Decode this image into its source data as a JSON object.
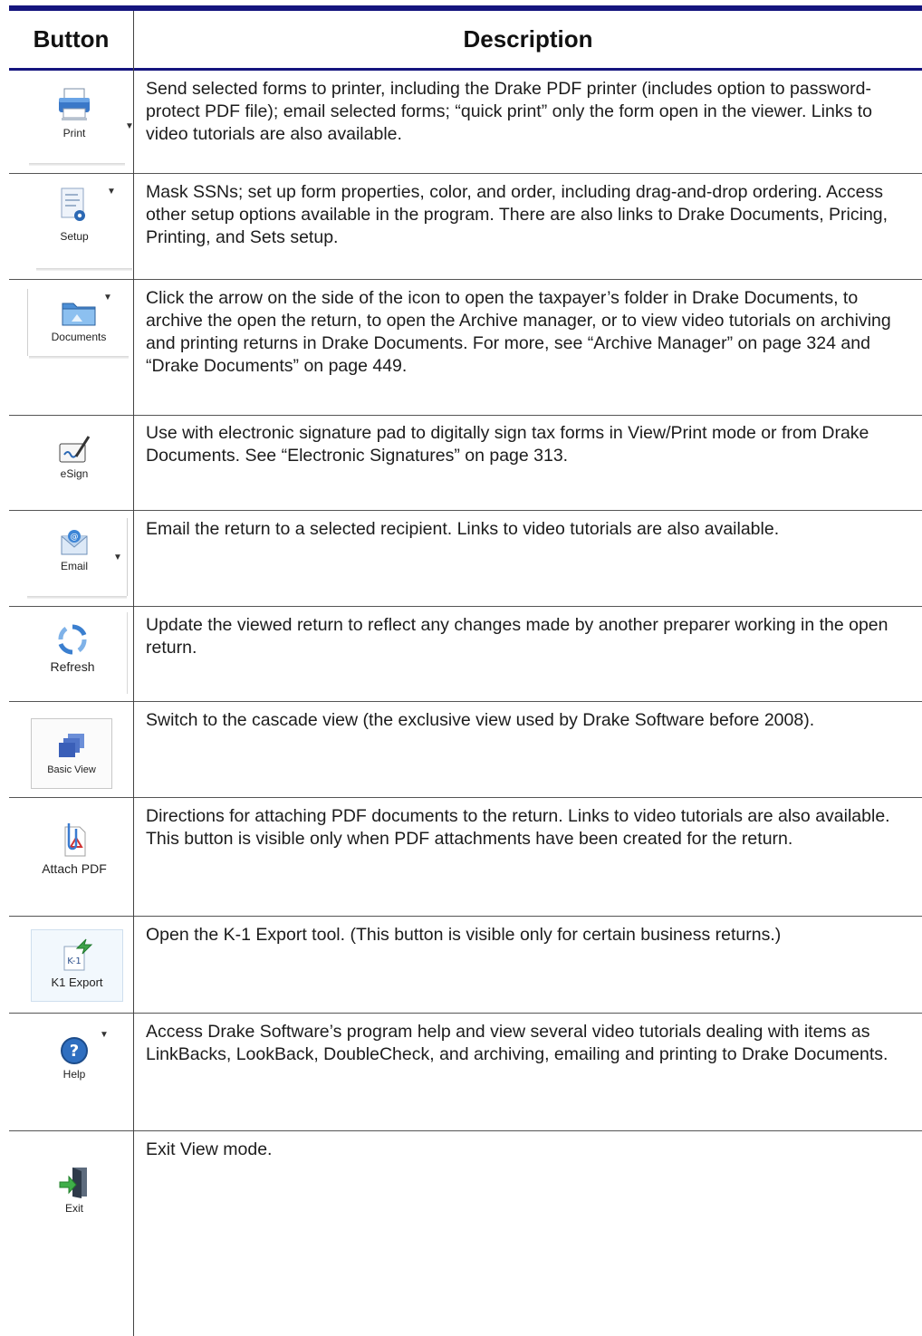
{
  "table": {
    "header": {
      "button": "Button",
      "description": "Description"
    },
    "rows": [
      {
        "icon": "printer-icon",
        "label": "Print",
        "description": "Send selected forms to printer, including the Drake PDF printer (includes option to password-protect PDF file); email selected forms; “quick print” only the form open in the viewer. Links to video tutorials are also available."
      },
      {
        "icon": "setup-icon",
        "label": "Setup",
        "description": "Mask SSNs; set up form properties, color, and order, including drag-and-drop ordering. Access other setup options available in the program. There are also links to Drake Documents, Pricing, Printing, and Sets setup."
      },
      {
        "icon": "folder-icon",
        "label": "Documents",
        "description": "Click the arrow on the side of the icon to open the taxpayer’s folder in Drake Documents, to archive the open the return, to open the Archive manager, or to view video tutorials on archiving and printing returns in Drake Documents. For more, see “Archive Manager” on page 324 and “Drake Documents” on page 449."
      },
      {
        "icon": "signature-pad-icon",
        "label": "eSign",
        "description": "Use with electronic signature pad to digitally sign tax forms in View/Print mode or from Drake Documents. See “Electronic Signatures” on page 313."
      },
      {
        "icon": "email-envelope-icon",
        "label": "Email",
        "description": "Email the return to a selected recipient. Links to video tutorials are also available."
      },
      {
        "icon": "refresh-icon",
        "label": "Refresh",
        "description": "Update the viewed return to reflect any changes made by another preparer working in the open return."
      },
      {
        "icon": "cascade-windows-icon",
        "label": "Basic View",
        "description": "Switch to the cascade view (the exclusive view used by Drake Software before 2008)."
      },
      {
        "icon": "paperclip-pdf-icon",
        "label": "Attach PDF",
        "description": "Directions for attaching PDF documents to the return. Links to video tutorials are also available. This button is visible only when PDF attachments have been created for the return."
      },
      {
        "icon": "k1-export-icon",
        "label": "K1 Export",
        "icon_text": "K-1",
        "description": "Open the K-1 Export tool. (This button is visible only for certain business returns.)"
      },
      {
        "icon": "help-icon",
        "label": "Help",
        "description": "Access Drake Software’s program help and view several video tutorials dealing with items as LinkBacks, LookBack, DoubleCheck, and archiving, emailing and printing to Drake Documents."
      },
      {
        "icon": "exit-door-icon",
        "label": "Exit",
        "description": "Exit View mode."
      }
    ]
  },
  "colors": {
    "rule": "#15157e",
    "grid": "#555555"
  }
}
